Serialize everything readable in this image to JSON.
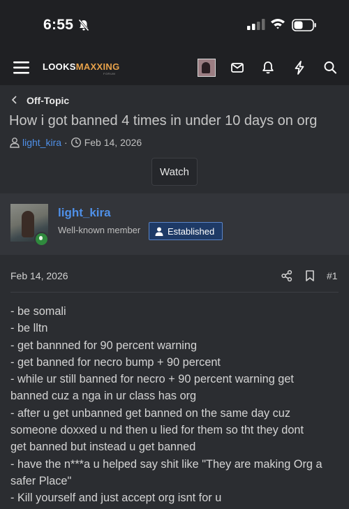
{
  "status_bar": {
    "time": "6:55"
  },
  "header": {
    "logo_part1": "LOOKS",
    "logo_part2": "MAXXING",
    "logo_sub": "FORUM",
    "icons": [
      "menu-icon",
      "avatar",
      "mail-icon",
      "bell-icon",
      "bolt-icon",
      "search-icon"
    ]
  },
  "thread": {
    "breadcrumb": "Off-Topic",
    "title": "How i got banned 4 times in under 10 days on org",
    "author": "light_kira",
    "separator": "·",
    "date": "Feb 14, 2026",
    "watch_label": "Watch"
  },
  "post": {
    "author": "light_kira",
    "user_title": "Well-known member",
    "badge": "Established",
    "date": "Feb 14, 2026",
    "number": "#1",
    "lines": [
      "- be somali",
      "- be lltn",
      "- get bannned for 90 percent warning",
      "- get banned for necro bump + 90 percent",
      "- while ur still banned for necro + 90 percent warning get",
      "banned cuz a nga in ur class has org",
      "- after u get unbanned get banned on the same day cuz",
      "someone doxxed u nd then u lied for them so tht they dont",
      "get banned but instead u get banned",
      "- have the n***a u helped say shit like \"They are making Org a",
      "safer Place\"",
      "- Kill yourself and just accept org isnt for u"
    ]
  },
  "colors": {
    "link": "#4f90e8",
    "logo_accent": "#e8a24a",
    "badge_bg": "#1e3a66",
    "online": "#2f8a3d"
  }
}
